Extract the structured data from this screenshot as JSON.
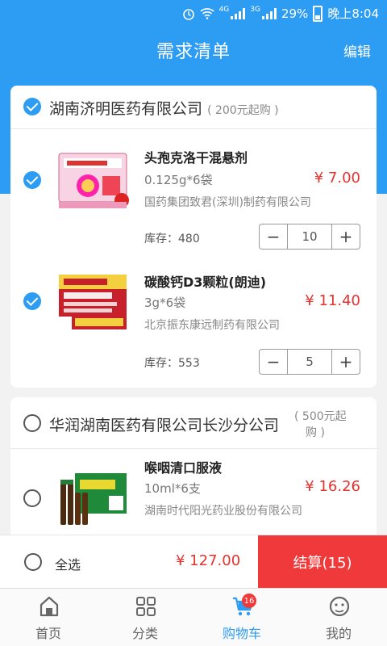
{
  "status_bar": {
    "battery": "29%",
    "time": "晚上8:04",
    "net1": "4G",
    "net2": "3G"
  },
  "header": {
    "title": "需求清单",
    "edit": "编辑"
  },
  "stores": [
    {
      "name": "湖南济明医药有限公司",
      "min_order": "( 200元起购 )",
      "checked": true,
      "products": [
        {
          "name": "头孢克洛干混悬剂",
          "spec": "0.125g*6袋",
          "price": "¥ 7.00",
          "maker": "国药集团致君(深圳)制药有限公司",
          "stock": "库存：480",
          "qty": "10",
          "checked": true
        },
        {
          "name": "碳酸钙D3颗粒(朗迪)",
          "spec": "3g*6袋",
          "price": "¥ 11.40",
          "maker": "北京振东康远制药有限公司",
          "stock": "库存：553",
          "qty": "5",
          "checked": true
        }
      ]
    },
    {
      "name": "华润湖南医药有限公司长沙分公司",
      "min_order_1": "( 500元起",
      "min_order_2": "购 )",
      "checked": false,
      "products": [
        {
          "name": "喉咽清口服液",
          "spec": "10ml*6支",
          "price": "¥ 16.26",
          "maker": "湖南时代阳光药业股份有限公司",
          "checked": false
        }
      ]
    }
  ],
  "checkout": {
    "select_all": "全选",
    "total": "¥ 127.00",
    "pay": "结算(15)"
  },
  "tabs": [
    {
      "label": "首页",
      "icon": "home-icon"
    },
    {
      "label": "分类",
      "icon": "category-icon"
    },
    {
      "label": "购物车",
      "icon": "cart-icon",
      "badge": "16",
      "active": true
    },
    {
      "label": "我的",
      "icon": "profile-icon"
    }
  ],
  "colors": {
    "primary": "#2d9cf3",
    "price": "#e8322e",
    "pay": "#f0393a"
  }
}
